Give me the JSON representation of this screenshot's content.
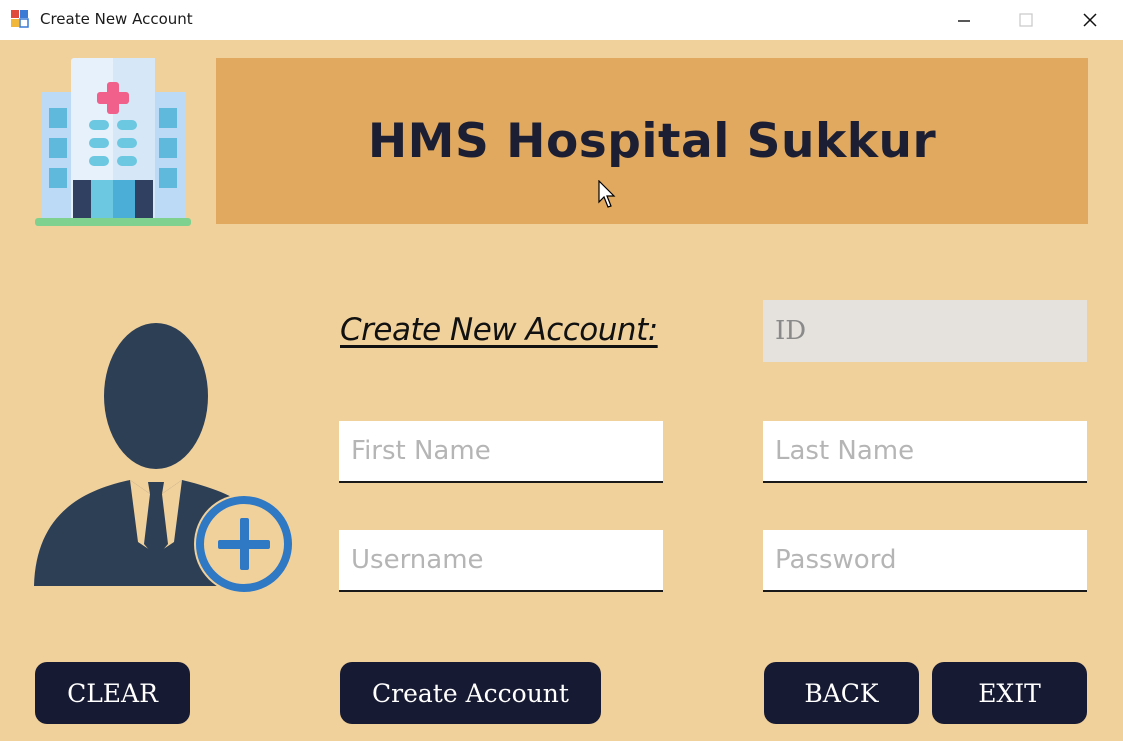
{
  "window": {
    "title": "Create New Account",
    "controls": {
      "minimize": "minimize",
      "maximize": "maximize",
      "close": "close"
    }
  },
  "header": {
    "title": "HMS Hospital Sukkur"
  },
  "form": {
    "heading": "Create New Account:",
    "fields": {
      "id": {
        "value": "",
        "placeholder": "ID"
      },
      "first_name": {
        "value": "",
        "placeholder": "First Name"
      },
      "last_name": {
        "value": "",
        "placeholder": "Last Name"
      },
      "username": {
        "value": "",
        "placeholder": "Username"
      },
      "password": {
        "value": "",
        "placeholder": "Password"
      }
    }
  },
  "buttons": {
    "clear": "CLEAR",
    "create": "Create Account",
    "back": "BACK",
    "exit": "EXIT"
  },
  "icons": {
    "app": "app-form-icon",
    "logo": "hospital-building-icon",
    "user": "user-add-icon"
  },
  "colors": {
    "background": "#f0d19c",
    "banner": "#e0a95f",
    "button": "#171a33",
    "title_text": "#1c1f33"
  }
}
